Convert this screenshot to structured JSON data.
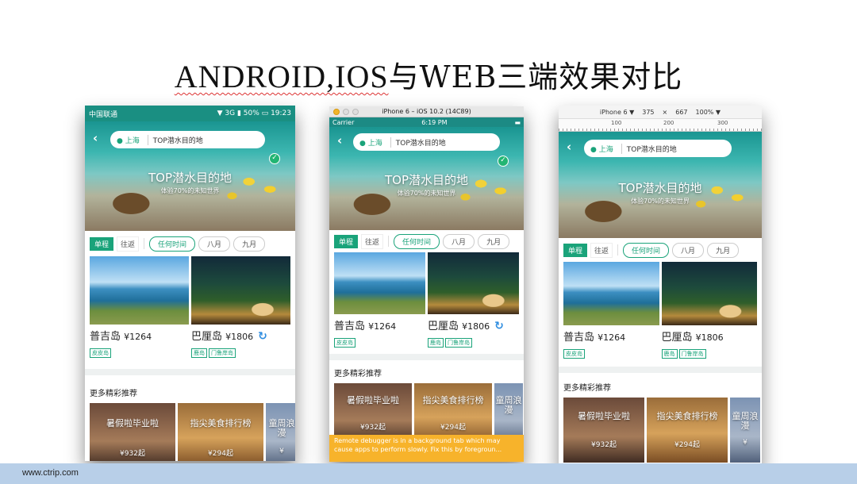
{
  "slide": {
    "title_latin": "ANDROID,IOS",
    "title_cn": "与WEB三端效果对比",
    "footer_url": "www.ctrip.com"
  },
  "common": {
    "city": "上海",
    "search_placeholder": "TOP潜水目的地",
    "hero_title": "TOP潜水目的地",
    "hero_sub": "体验70%的未知世界",
    "tab_oneway": "单程",
    "tab_roundtrip": "往返",
    "pill_anytime": "任何时间",
    "pill_aug": "八月",
    "pill_sep": "九月",
    "dest1_name": "普吉岛",
    "dest1_price": "¥1264",
    "dest1_tag": "皮皮岛",
    "dest2_name": "巴厘岛",
    "dest2_price": "¥1806",
    "dest2_tag1": "鹿岛",
    "dest2_tag2": "门鲁岸岛",
    "more_title": "更多精彩推荐",
    "rec1_title": "暑假啦毕业啦",
    "rec1_price": "¥932起",
    "rec2_title": "指尖美食排行榜",
    "rec2_price": "¥294起",
    "rec3_title": "童周浪漫",
    "rec3_price": "¥"
  },
  "android": {
    "carrier": "中国联通",
    "signal": "3G",
    "battery": "50%",
    "time": "19:23"
  },
  "ios": {
    "window_title": "iPhone 6 – iOS 10.2 (14C89)",
    "carrier": "Carrier",
    "time": "6:19 PM",
    "debugger_msg": "Remote debugger is in a background tab which may cause apps to perform slowly. Fix this by foregroun..."
  },
  "web": {
    "device": "iPhone 6 ▼",
    "width": "375",
    "times": "×",
    "height": "667",
    "zoom": "100% ▼",
    "ruler_100": "100",
    "ruler_200": "200",
    "ruler_300": "300"
  },
  "colors": {
    "accent": "#1aa37a",
    "footer": "#b8cfe8",
    "debug": "#f7b32b"
  }
}
